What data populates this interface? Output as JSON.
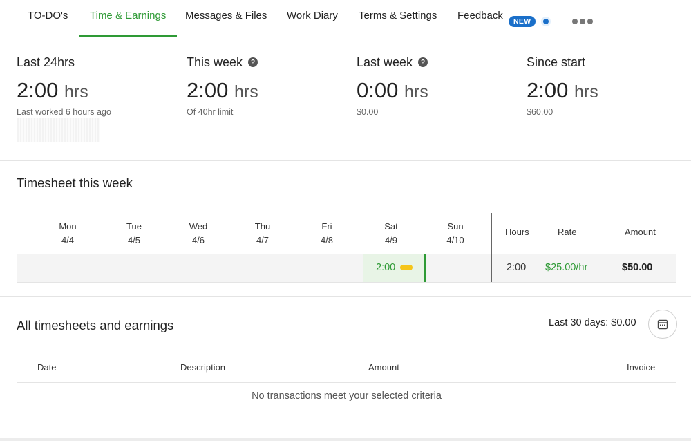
{
  "tabs": [
    {
      "label": "TO-DO's"
    },
    {
      "label": "Time & Earnings"
    },
    {
      "label": "Messages & Files"
    },
    {
      "label": "Work Diary"
    },
    {
      "label": "Terms & Settings"
    },
    {
      "label": "Feedback"
    }
  ],
  "active_tab": "Time & Earnings",
  "feedback_badge": "NEW",
  "stats": {
    "last24": {
      "title": "Last 24hrs",
      "value": "2:00",
      "unit": "hrs",
      "sub": "Last worked 6 hours ago"
    },
    "this_week": {
      "title": "This week",
      "value": "2:00",
      "unit": "hrs",
      "sub": "Of 40hr limit"
    },
    "last_week": {
      "title": "Last week",
      "value": "0:00",
      "unit": "hrs",
      "sub": "$0.00"
    },
    "since_start": {
      "title": "Since start",
      "value": "2:00",
      "unit": "hrs",
      "sub": "$60.00"
    }
  },
  "timesheet": {
    "title": "Timesheet this week",
    "days": [
      {
        "day": "Mon",
        "date": "4/4"
      },
      {
        "day": "Tue",
        "date": "4/5"
      },
      {
        "day": "Wed",
        "date": "4/6"
      },
      {
        "day": "Thu",
        "date": "4/7"
      },
      {
        "day": "Fri",
        "date": "4/8"
      },
      {
        "day": "Sat",
        "date": "4/9"
      },
      {
        "day": "Sun",
        "date": "4/10"
      }
    ],
    "columns": {
      "hours": "Hours",
      "rate": "Rate",
      "amount": "Amount"
    },
    "row": {
      "sat_value": "2:00",
      "hours": "2:00",
      "rate": "$25.00/hr",
      "amount": "$50.00"
    }
  },
  "all_timesheets": {
    "title": "All timesheets and earnings",
    "summary": "Last 30 days: $0.00",
    "columns": {
      "date": "Date",
      "description": "Description",
      "amount": "Amount",
      "invoice": "Invoice"
    },
    "empty_message": "No transactions meet your selected criteria"
  },
  "colors": {
    "accent": "#2e9a35",
    "badge": "#1a6fc9",
    "pill": "#f5c518"
  },
  "icons": {
    "help": "question-circle-icon",
    "calendar": "calendar-icon",
    "more": "ellipsis-icon"
  }
}
